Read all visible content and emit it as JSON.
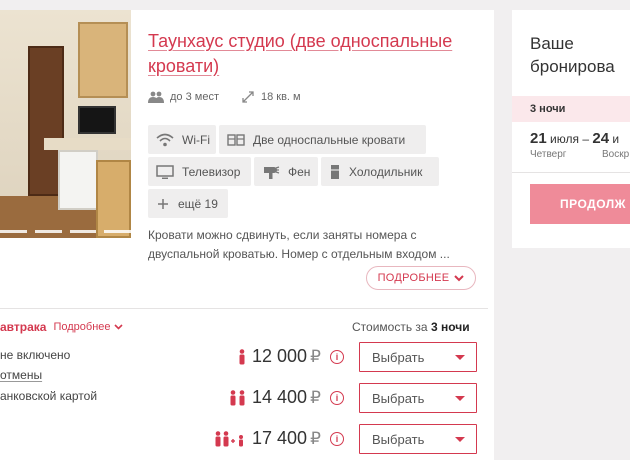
{
  "room": {
    "title": "Таунхаус студио (две односпальные кровати)",
    "guests": "до 3 мест",
    "area": "18 кв. м",
    "amenities": [
      {
        "label": "Wi-Fi",
        "icon": "wifi-icon"
      },
      {
        "label": "Две односпальные кровати",
        "icon": "twin-beds-icon"
      },
      {
        "label": "Телевизор",
        "icon": "tv-icon"
      },
      {
        "label": "Фен",
        "icon": "hairdryer-icon"
      },
      {
        "label": "Холодильник",
        "icon": "fridge-icon"
      },
      {
        "label": "ещё 19",
        "icon": "plus-icon"
      }
    ],
    "description_line1": "Кровати можно сдвинуть, если заняты номера с",
    "description_line2": "двуспальной кроватью. Номер с отдельным входом ...",
    "more_button": "ПОДРОБНЕЕ"
  },
  "rates": {
    "breakfast_label": "автрака",
    "breakfast_more": "Подробнее",
    "cost_prefix": "Стоимость за",
    "cost_nights": "3 ночи",
    "conditions": [
      "не включено",
      "отмены",
      "анковской картой"
    ],
    "rows": [
      {
        "price": "12 000",
        "currency": "₽",
        "select": "Выбрать",
        "guests_icon": "one-guest-icon"
      },
      {
        "price": "14 400",
        "currency": "₽",
        "select": "Выбрать",
        "guests_icon": "two-guests-icon"
      },
      {
        "price": "17 400",
        "currency": "₽",
        "select": "Выбрать",
        "guests_icon": "two-guests-plus-child-icon"
      }
    ]
  },
  "booking": {
    "title_line1": "Ваше",
    "title_line2": "бронирова",
    "nights": "3 ночи",
    "checkin_day": "21",
    "checkin_month": "июля",
    "dash": "–",
    "checkout_day": "24",
    "checkout_month": "и",
    "checkin_dow": "Четверг",
    "checkout_dow": "Воскр",
    "cta": "ПРОДОЛЖ"
  },
  "colors": {
    "accent": "#d4394f",
    "cta": "#ef8b99",
    "nights_bg": "#fbe8eb",
    "chip_bg": "#efeeee"
  }
}
